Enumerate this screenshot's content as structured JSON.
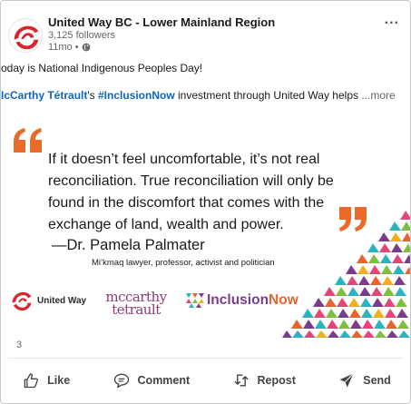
{
  "post": {
    "author": "United Way BC - Lower Mainland Region",
    "followers": "3,125 followers",
    "age": "11mo •",
    "menu_label": "...",
    "line1": "oday is National Indigenous Peoples Day!",
    "line2_mention": "IcCarthy Tétrault",
    "line2_apostrophe": "'s ",
    "line2_hashtag": "#InclusionNow",
    "line2_rest": " investment through United Way helps ",
    "line2_more": "...more"
  },
  "image": {
    "quote": "If it doesn’t feel uncomfortable, it’s not real reconciliation. True reconciliation will only be found in the discomfort that comes with the exchange of land, wealth and power.",
    "attribution": "—Dr. Pamela Palmater",
    "role": "Mi’kmaq lawyer, professor, activist and politician",
    "logos": {
      "united_way": "United Way",
      "mccarthy_line1": "mccarthy",
      "mccarthy_line2": "tetrault",
      "inclusion_a": "Inclusion",
      "inclusion_b": "Now"
    }
  },
  "engagement": {
    "reaction_count": "3"
  },
  "actions": {
    "like": "Like",
    "comment": "Comment",
    "repost": "Repost",
    "send": "Send"
  },
  "colors": {
    "link": "#0a66c2",
    "quote_mark": "#ea6a2a",
    "united_way_red": "#d8262c",
    "mccarthy_purple": "#8c3b7a"
  },
  "icons": {
    "menu": "more-horizontal-icon",
    "globe": "globe-icon",
    "like": "thumbs-up-icon",
    "comment": "comment-icon",
    "repost": "repost-icon",
    "send": "send-icon"
  }
}
